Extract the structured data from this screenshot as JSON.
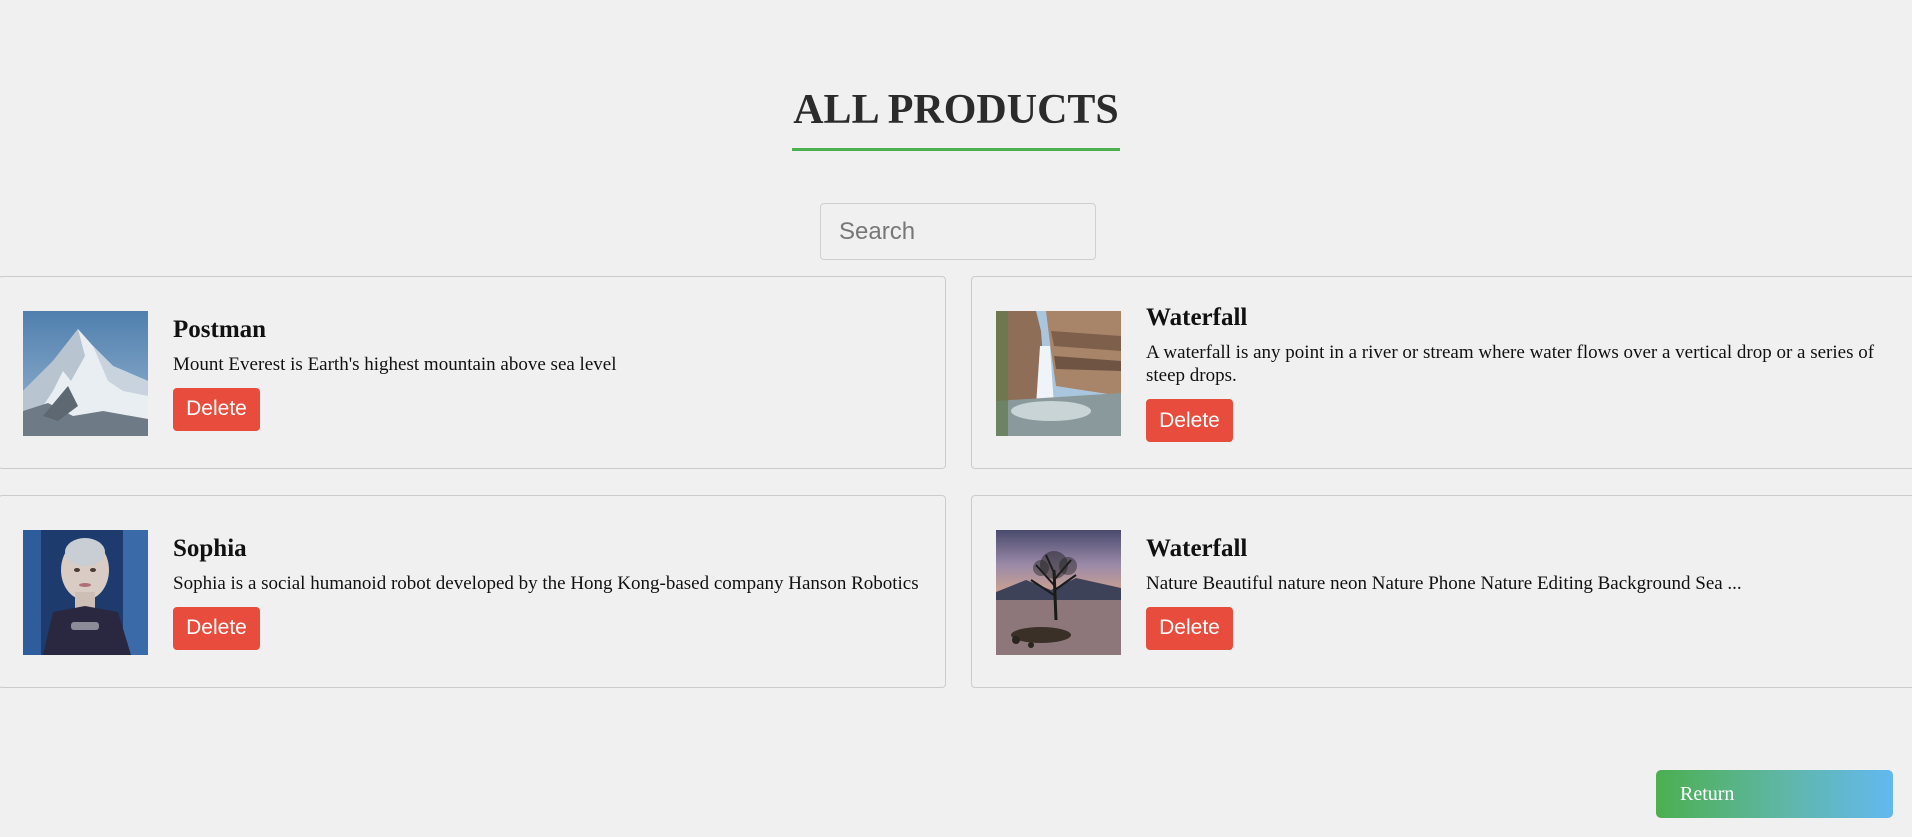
{
  "header": {
    "title": "ALL PRODUCTS"
  },
  "search": {
    "placeholder": "Search",
    "value": ""
  },
  "products": [
    {
      "name": "Postman",
      "description": "Mount Everest is Earth's highest mountain above sea level",
      "delete_label": "Delete",
      "image": "mountain-photo"
    },
    {
      "name": "Waterfall",
      "description": "A waterfall is any point in a river or stream where water flows over a vertical drop or a series of steep drops.",
      "delete_label": "Delete",
      "image": "waterfall-photo"
    },
    {
      "name": "Sophia",
      "description": "Sophia is a social humanoid robot developed by the Hong Kong-based company Hanson Robotics",
      "delete_label": "Delete",
      "image": "robot-photo"
    },
    {
      "name": "Waterfall",
      "description": "Nature Beautiful nature neon Nature Phone Nature Editing Background Sea ...",
      "delete_label": "Delete",
      "image": "lake-tree-photo"
    }
  ],
  "footer": {
    "return_label": "Return"
  },
  "colors": {
    "accent": "#4caf50",
    "delete": "#e74c3c",
    "return_gradient_end": "#63b8f0"
  }
}
